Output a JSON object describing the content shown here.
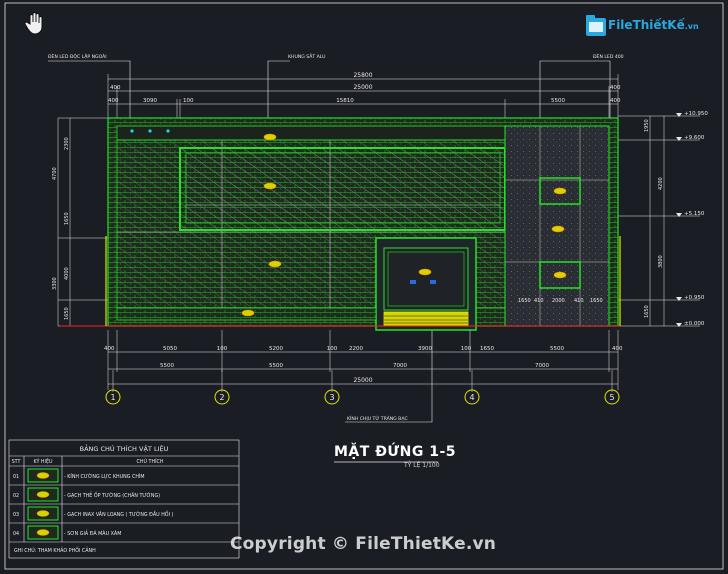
{
  "header": {
    "logo_text": "FileThiếtKế",
    "logo_suffix": ".vn"
  },
  "drawing": {
    "title": "MẶT ĐỨNG 1-5",
    "scale": "TỶ LỆ 1/100",
    "callouts": [
      "ĐÈN LED ĐỘC LẬP NGOÀI",
      "KHUNG SẮT ALU",
      "ĐÈN LED 400",
      "KÍNH CHỊU TỪ TRÁNG BẠC"
    ],
    "dims_top_row1": [
      "25800"
    ],
    "dims_top_row2": [
      "400",
      "25000",
      "400"
    ],
    "dims_top_row3": [
      "400",
      "3090",
      "100",
      "15810",
      "5500",
      "400"
    ],
    "dims_bottom_row1": [
      "400",
      "5050",
      "100",
      "5200",
      "100",
      "2200",
      "3900",
      "100",
      "1650",
      "5500",
      "400"
    ],
    "dims_bottom_row2": [
      "5500",
      "5500",
      "7000",
      "7000"
    ],
    "dims_bottom_row3": [
      "25000"
    ],
    "levels": [
      "+10.950",
      "+9.600",
      "+5.150",
      "+0.950",
      "±0.000"
    ],
    "left_dims": [
      "4700",
      "2300",
      "1650",
      "4000",
      "3300",
      "1650"
    ],
    "right_dims": [
      "1950",
      "4200",
      "3800",
      "1650"
    ],
    "inner_dims": [
      "1650",
      "410",
      "2000",
      "410",
      "1650"
    ],
    "tags": [
      "01",
      "02",
      "03",
      "04"
    ],
    "axes": [
      "1",
      "2",
      "3",
      "4",
      "5"
    ]
  },
  "legend": {
    "title": "BẢNG CHÚ THÍCH VẬT LIỆU",
    "columns": [
      "STT",
      "KÝ HIỆU",
      "CHÚ THÍCH"
    ],
    "rows": [
      {
        "stt": "01",
        "symbol": "01",
        "note": "- KÍNH CƯỜNG LỰC KHUNG CHÌM"
      },
      {
        "stt": "02",
        "symbol": "02",
        "note": "- GẠCH THẺ ỐP TƯỜNG (CHÂN TƯỜNG)"
      },
      {
        "stt": "03",
        "symbol": "03",
        "note": "- GẠCH INAX VÂN LOANG ( TƯỜNG ĐẦU HỒI )"
      },
      {
        "stt": "04",
        "symbol": "04",
        "note": "- SƠN GIẢ ĐÁ MÀU XÁM"
      }
    ],
    "footnote": "GHI CHÚ: THAM KHẢO PHỐI CẢNH"
  },
  "watermark": "Copyright © FileThietKe.vn",
  "colors": {
    "background": "#1a1d24",
    "green": "#22e622",
    "white": "#e8e8e8",
    "yellow": "#e6e600",
    "red": "#ff2020",
    "cyan": "#2aa8e0"
  }
}
